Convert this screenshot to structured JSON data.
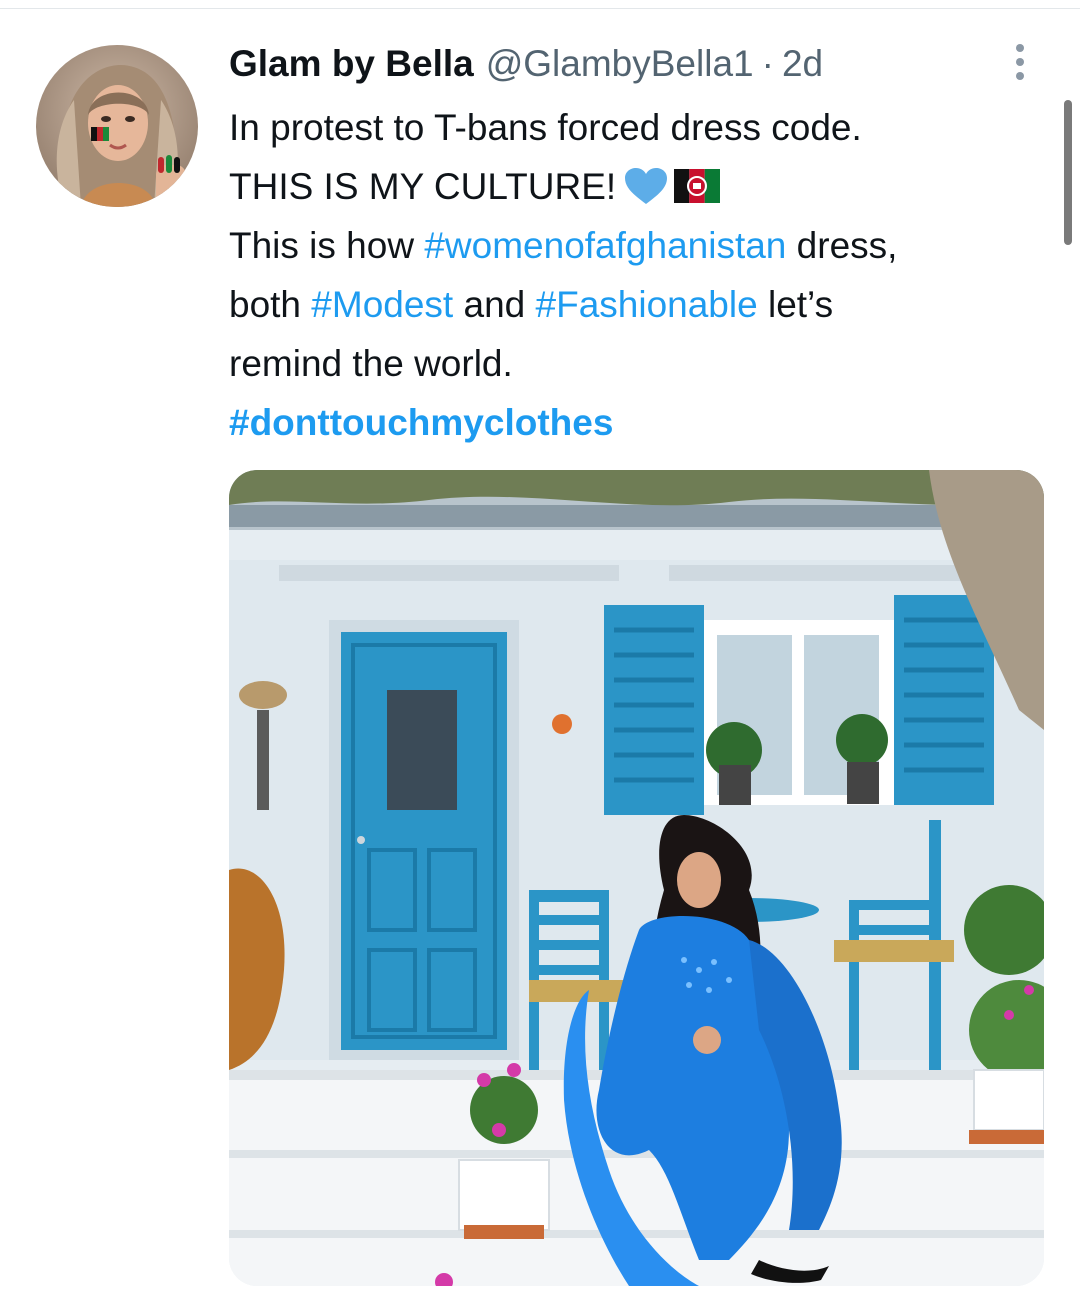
{
  "tweet": {
    "author_name": "Glam by Bella",
    "author_handle": "@GlambyBella1",
    "separator": "·",
    "time_ago": "2d",
    "lines": {
      "l1": "In protest to T-bans forced dress code.",
      "l2": "THIS IS MY CULTURE!",
      "l3_a": "This is how ",
      "l3_tag": "#womenofafghanistan",
      "l3_b": " dress,",
      "l4_a": "both ",
      "l4_tag1": "#Modest",
      "l4_b": " and ",
      "l4_tag2": "#Fashionable",
      "l4_c": " let’s",
      "l5": "remind the world.",
      "l6_tag": "#donttouchmyclothes"
    },
    "emoji": [
      "blue-heart-icon",
      "afghanistan-flag-icon"
    ]
  },
  "colors": {
    "link": "#1d9bf0",
    "text": "#0f1419",
    "muted": "#536471",
    "heart": "#5dade8"
  }
}
